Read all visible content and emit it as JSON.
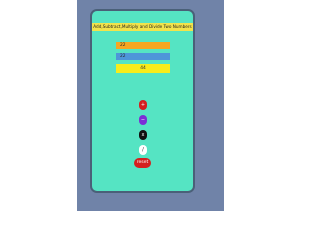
{
  "app": {
    "title": "Add,Subtract,Multiply and Divide Two Numbers"
  },
  "inputs": {
    "first_value": "22",
    "second_value": "22"
  },
  "result": {
    "value": "44"
  },
  "operators": {
    "add": "+",
    "subtract": "−",
    "multiply": "x",
    "divide": "/"
  },
  "reset_label": "reset",
  "colors": {
    "screen": "#55e4c3",
    "title_bar": "#f2e34b",
    "first_field": "#f5a623",
    "second_field": "#4e95d9",
    "result_box": "#f7ec1b",
    "add_button": "#d41f1f",
    "subtract_button": "#7b2fd6",
    "multiply_button": "#111111",
    "divide_button": "#ffffff",
    "reset_button": "#d41f1f"
  }
}
